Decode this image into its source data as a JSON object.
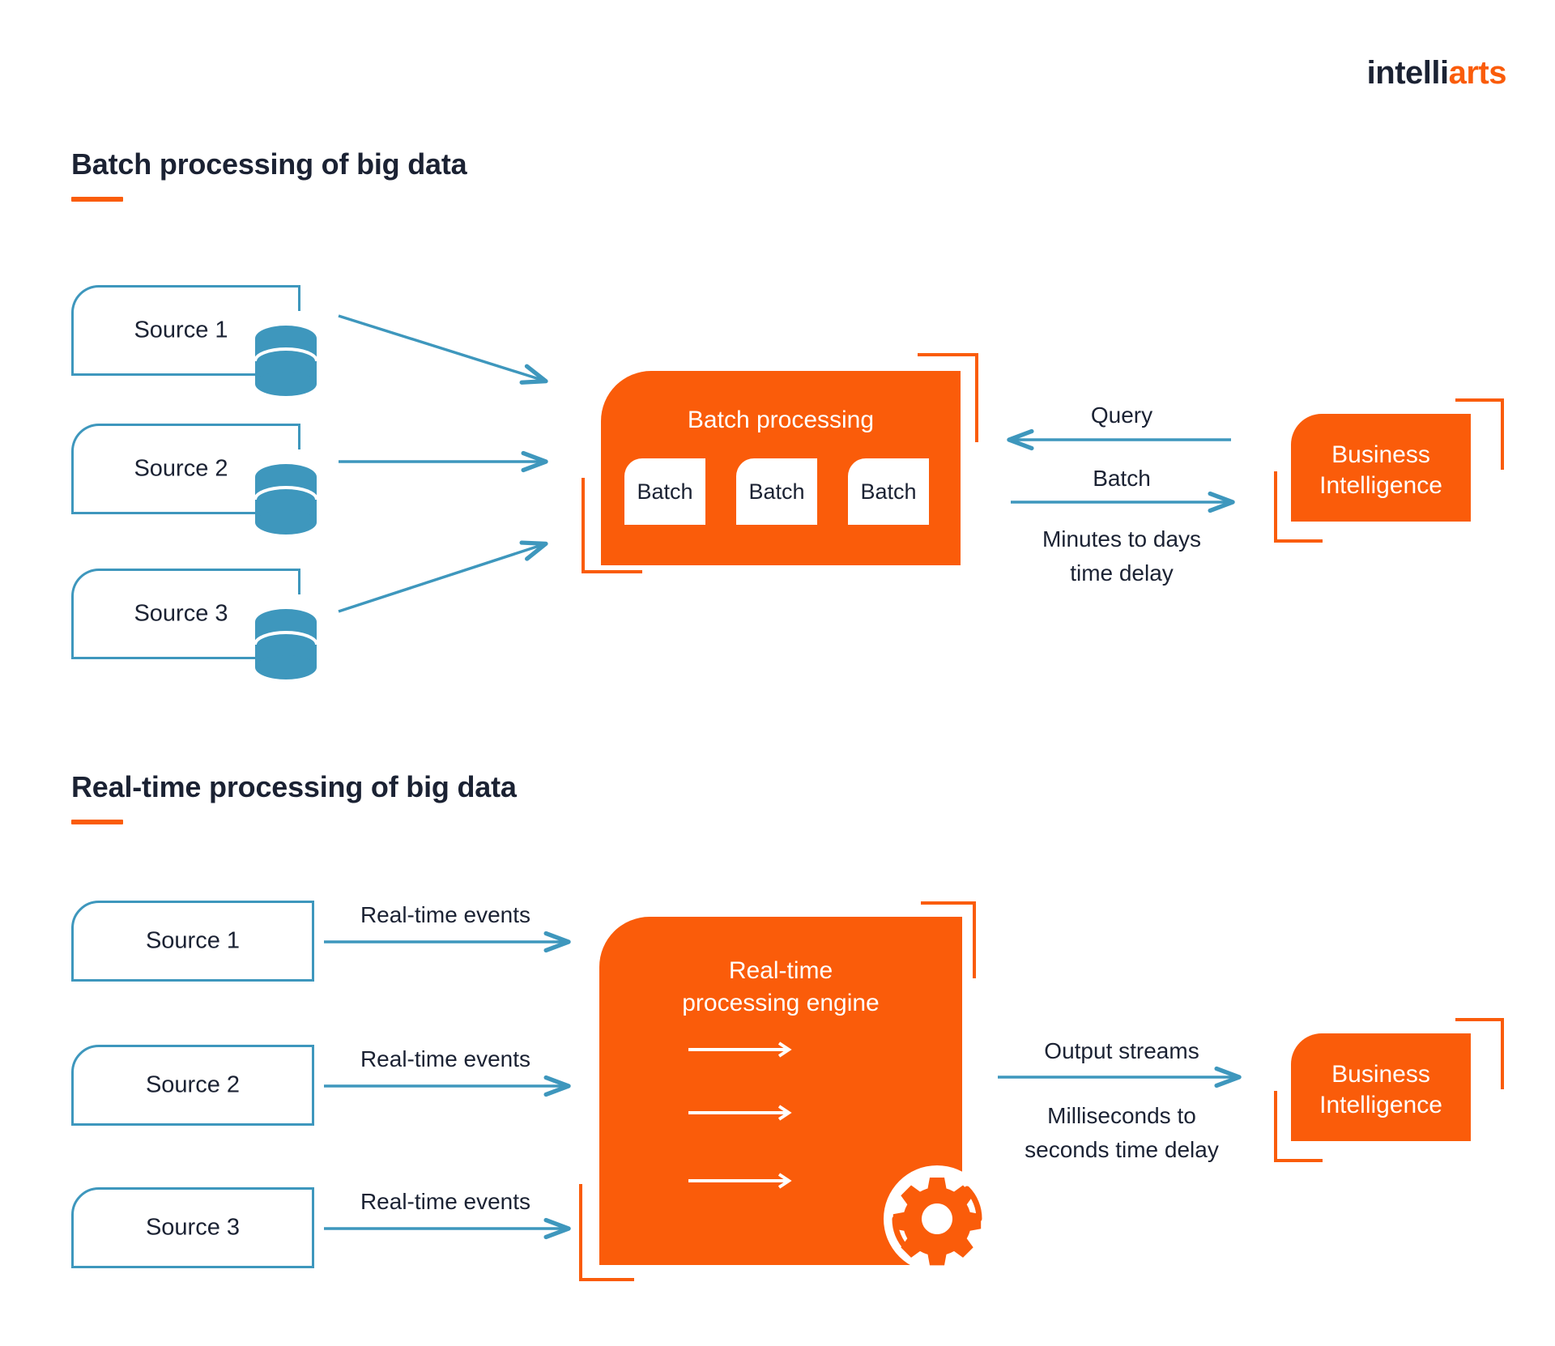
{
  "logo": {
    "part1": "intelli",
    "part2": "arts"
  },
  "colors": {
    "orange": "#fa5c0a",
    "teal": "#3e97bd",
    "dark": "#1b2233",
    "white": "#ffffff",
    "background": "#ffffff"
  },
  "sections": {
    "batch": {
      "title": "Batch processing of big data",
      "sources": [
        {
          "label": "Source 1",
          "icon": "database-icon"
        },
        {
          "label": "Source 2",
          "icon": "database-icon"
        },
        {
          "label": "Source 3",
          "icon": "database-icon"
        }
      ],
      "engine": {
        "title": "Batch processing",
        "chips": [
          "Batch",
          "Batch",
          "Batch"
        ]
      },
      "flows": {
        "query_label": "Query",
        "batch_label": "Batch",
        "delay_line1": "Minutes to days",
        "delay_line2": "time delay"
      },
      "destination": {
        "line1": "Business",
        "line2": "Intelligence"
      }
    },
    "realtime": {
      "title": "Real-time processing of big data",
      "sources": [
        {
          "label": "Source 1",
          "event_label": "Real-time events"
        },
        {
          "label": "Source 2",
          "event_label": "Real-time events"
        },
        {
          "label": "Source 3",
          "event_label": "Real-time events"
        }
      ],
      "engine": {
        "title_line1": "Real-time",
        "title_line2": "processing engine",
        "icon": "gear-icon",
        "internal_streams": 3
      },
      "flows": {
        "output_label": "Output streams",
        "delay_line1": "Milliseconds to",
        "delay_line2": "seconds time delay"
      },
      "destination": {
        "line1": "Business",
        "line2": "Intelligence"
      }
    }
  }
}
